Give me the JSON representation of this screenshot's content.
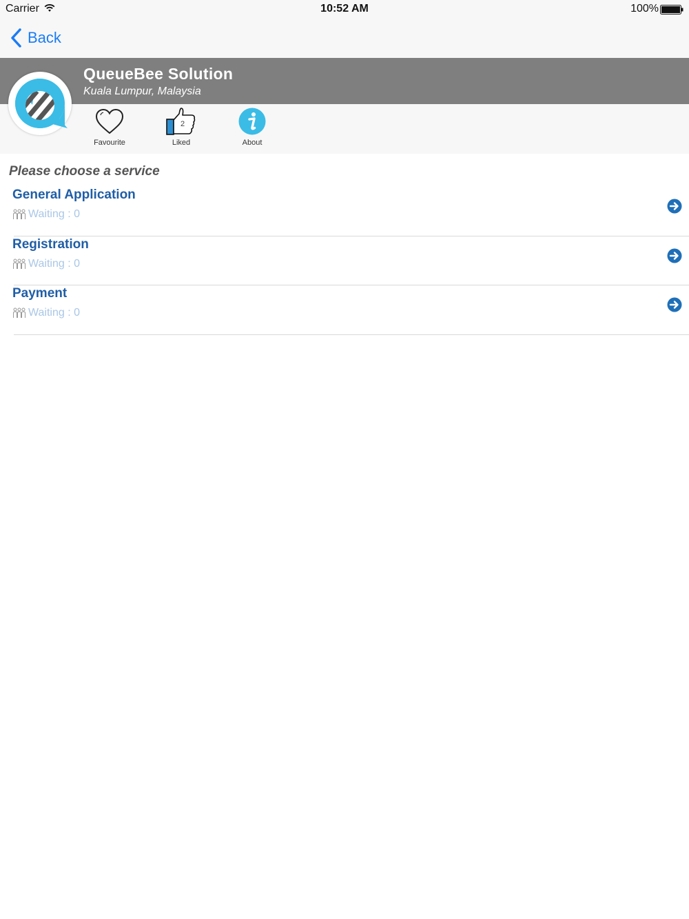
{
  "status_bar": {
    "carrier": "Carrier",
    "time": "10:52 AM",
    "battery": "100%"
  },
  "nav": {
    "back_label": "Back"
  },
  "header": {
    "title": "QueueBee Solution",
    "subtitle": "Kuala Lumpur, Malaysia"
  },
  "actions": [
    {
      "label": "Favourite",
      "icon": "heart-icon"
    },
    {
      "label": "Liked",
      "icon": "thumbs-up-icon",
      "count": "2"
    },
    {
      "label": "About",
      "icon": "info-icon"
    }
  ],
  "services": {
    "heading": "Please choose a service",
    "items": [
      {
        "name": "General Application",
        "waiting": "Waiting : 0"
      },
      {
        "name": "Registration",
        "waiting": "Waiting : 0"
      },
      {
        "name": "Payment",
        "waiting": "Waiting : 0"
      }
    ]
  },
  "colors": {
    "accent": "#1a7cf5",
    "header_band": "#7f7f7f",
    "service_name": "#1f5ea6",
    "waiting_text": "#a9c6e6",
    "brand_cyan": "#3bbce6"
  }
}
